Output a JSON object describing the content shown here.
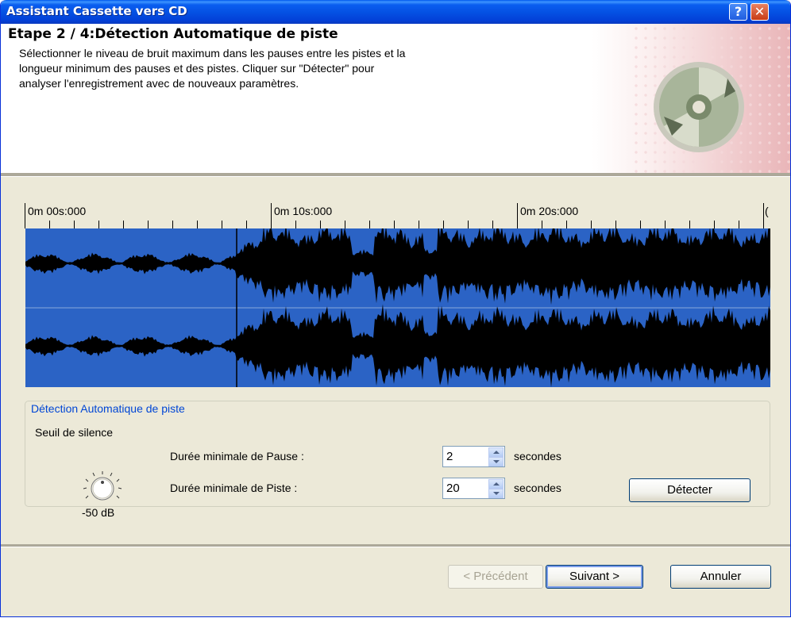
{
  "window": {
    "title": "Assistant Cassette vers CD"
  },
  "title_buttons": {
    "help": "?",
    "close": "✕"
  },
  "header": {
    "step_title": "Etape 2 / 4:Détection Automatique de piste",
    "description_lines": [
      "Sélectionner le niveau de bruit maximum dans les pauses entre les pistes et la",
      "longueur minimum des pauses et des pistes. Cliquer sur \"Détecter\" pour",
      "analyser l'enregistrement avec de nouveaux paramètres."
    ],
    "icon": "cd-disc-icon"
  },
  "timeline": {
    "labels": [
      "0m 00s:000",
      "0m 10s:000",
      "0m 20s:000",
      "("
    ]
  },
  "detection": {
    "group_title": "Détection Automatique de piste",
    "silence_threshold_label": "Seuil de silence",
    "silence_value": "-50 dB",
    "min_pause_label": "Durée minimale de Pause :",
    "min_pause_value": "2",
    "min_track_label": "Durée minimale de Piste :",
    "min_track_value": "20",
    "unit": "secondes",
    "detect_button": "Détecter"
  },
  "footer": {
    "prev": "< Précédent",
    "next": "Suivant >",
    "cancel": "Annuler"
  },
  "colors": {
    "waveform_bg": "#2b63c5",
    "waveform_fg": "#000000",
    "titlebar": "#0454e4"
  }
}
